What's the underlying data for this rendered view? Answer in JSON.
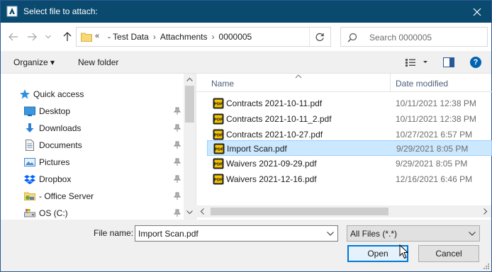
{
  "window": {
    "title": "Select file to attach:",
    "close_glyph": "✕"
  },
  "nav": {
    "back_glyph": "←",
    "forward_glyph": "→",
    "recent_glyph": "⌄",
    "up_glyph": "↑",
    "address": {
      "overflow": "«",
      "crumbs": [
        "- Test Data",
        "Attachments",
        "0000005"
      ],
      "separator": "›",
      "dropdown_glyph": "⌄",
      "refresh_glyph": "↻"
    },
    "search": {
      "placeholder": "Search 0000005"
    }
  },
  "toolbar": {
    "organize_label": "Organize ▾",
    "new_folder_label": "New folder",
    "help_glyph": "?"
  },
  "sidebar": {
    "items": [
      {
        "label": "Quick access",
        "icon": "star-icon",
        "pinned": false
      },
      {
        "label": "Desktop",
        "icon": "desktop-icon",
        "pinned": true
      },
      {
        "label": "Downloads",
        "icon": "downloads-icon",
        "pinned": true
      },
      {
        "label": "Documents",
        "icon": "documents-icon",
        "pinned": true
      },
      {
        "label": "Pictures",
        "icon": "pictures-icon",
        "pinned": true
      },
      {
        "label": "Dropbox",
        "icon": "dropbox-icon",
        "pinned": true
      },
      {
        "label": "- Office Server",
        "icon": "network-folder-icon",
        "pinned": true
      },
      {
        "label": "OS (C:)",
        "icon": "drive-icon",
        "pinned": true
      }
    ]
  },
  "files": {
    "columns": {
      "name": "Name",
      "date": "Date modified"
    },
    "rows": [
      {
        "name": "Contracts 2021-10-11.pdf",
        "date": "10/11/2021 12:38 PM",
        "selected": false
      },
      {
        "name": "Contracts 2021-10-11_2.pdf",
        "date": "10/11/2021 12:38 PM",
        "selected": false
      },
      {
        "name": "Contracts 2021-10-27.pdf",
        "date": "10/27/2021 6:57 PM",
        "selected": false
      },
      {
        "name": "Import Scan.pdf",
        "date": "9/29/2021 8:05 PM",
        "selected": true
      },
      {
        "name": "Waivers 2021-09-29.pdf",
        "date": "9/29/2021 8:05 PM",
        "selected": false
      },
      {
        "name": "Waivers 2021-12-16.pdf",
        "date": "12/16/2021 6:46 PM",
        "selected": false
      }
    ]
  },
  "footer": {
    "file_name_label": "File name:",
    "file_name_value": "Import Scan.pdf",
    "file_type_value": "All Files (*.*)",
    "open_label": "Open",
    "cancel_label": "Cancel"
  },
  "colors": {
    "titlebar": "#0b4a6f",
    "selection": "#cce8ff",
    "accent": "#0078d7"
  }
}
